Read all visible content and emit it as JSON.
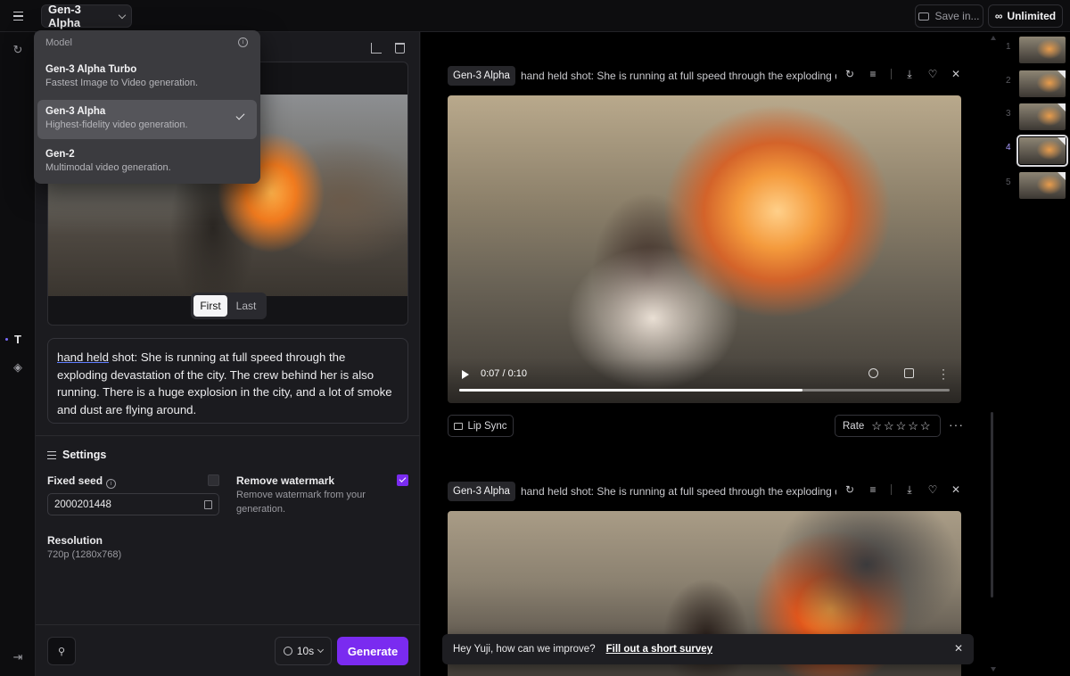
{
  "topbar": {
    "model_label": "Gen-3 Alpha",
    "save_label": "Save in...",
    "plan_label": "Unlimited"
  },
  "dropdown": {
    "header": "Model",
    "items": [
      {
        "title": "Gen-3 Alpha Turbo",
        "desc": "Fastest Image to Video generation."
      },
      {
        "title": "Gen-3 Alpha",
        "desc": "Highest-fidelity video generation.",
        "selected": true
      },
      {
        "title": "Gen-2",
        "desc": "Multimodal video generation."
      }
    ]
  },
  "frame_toggle": {
    "first": "First",
    "last": "Last"
  },
  "prompt": {
    "underlined": "hand held",
    "rest": " shot: She is running at full speed through the exploding devastation of the city. The crew behind her is also running. There is a huge explosion in the city, and a lot of smoke and dust are flying around."
  },
  "settings": {
    "title": "Settings",
    "fixed_seed_label": "Fixed seed",
    "seed_value": "2000201448",
    "fixed_seed_checked": false,
    "watermark_label": "Remove watermark",
    "watermark_desc": "Remove watermark from your generation.",
    "watermark_checked": true,
    "resolution_label": "Resolution",
    "resolution_value": "720p (1280x768)"
  },
  "footer": {
    "duration": "10s",
    "generate_label": "Generate"
  },
  "cards": [
    {
      "tag": "Gen-3 Alpha",
      "prompt": "hand held shot: She is running at full speed through the exploding dev...",
      "time": "0:07 / 0:10",
      "progress": 0.7
    },
    {
      "tag": "Gen-3 Alpha",
      "prompt": "hand held shot: She is running at full speed through the exploding dev..."
    }
  ],
  "card_actions": {
    "lip_sync": "Lip Sync",
    "rate": "Rate"
  },
  "toast": {
    "text": "Hey Yuji, how can we improve?",
    "link": "Fill out a short survey"
  },
  "thumbnails": [
    {
      "n": "1"
    },
    {
      "n": "2"
    },
    {
      "n": "3"
    },
    {
      "n": "4",
      "active": true
    },
    {
      "n": "5"
    }
  ],
  "colors": {
    "accent": "#7a2bf0",
    "panel": "#1b1b1f",
    "background": "#0d0d0f"
  }
}
